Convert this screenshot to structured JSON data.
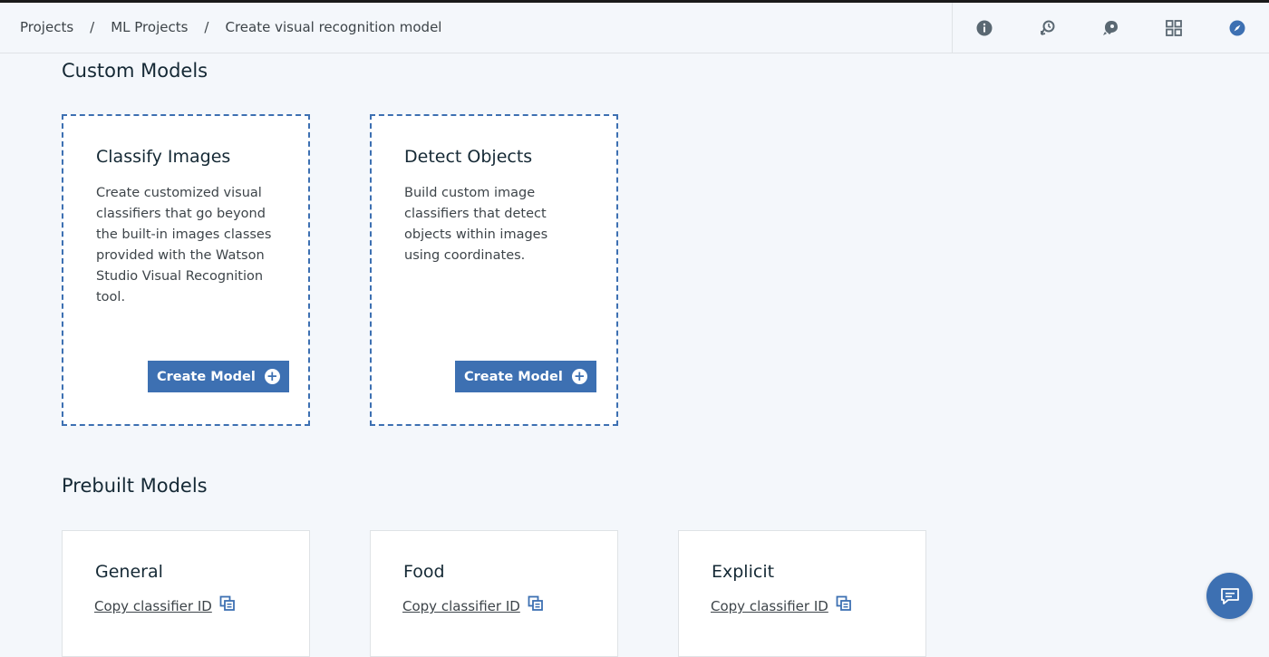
{
  "breadcrumb": {
    "items": [
      "Projects",
      "ML Projects"
    ],
    "separator": "/",
    "current": "Create visual recognition model"
  },
  "header_icons": [
    "info-icon",
    "history-icon",
    "deploy-icon",
    "apps-grid-icon",
    "compass-icon"
  ],
  "custom_models": {
    "title": "Custom Models",
    "cards": [
      {
        "title": "Classify Images",
        "description": "Create customized visual classifiers that go beyond the built-in images classes provided with the Watson Studio Visual Recognition tool.",
        "button_label": "Create Model"
      },
      {
        "title": "Detect Objects",
        "description": "Build custom image classifiers that detect objects within images using coordinates.",
        "button_label": "Create Model"
      }
    ]
  },
  "prebuilt_models": {
    "title": "Prebuilt Models",
    "cards": [
      {
        "title": "General",
        "link_label": "Copy classifier ID"
      },
      {
        "title": "Food",
        "link_label": "Copy classifier ID"
      },
      {
        "title": "Explicit",
        "link_label": "Copy classifier ID"
      }
    ]
  },
  "colors": {
    "accent": "#3d70b2",
    "background": "#f4f7fb",
    "text": "#152935"
  }
}
